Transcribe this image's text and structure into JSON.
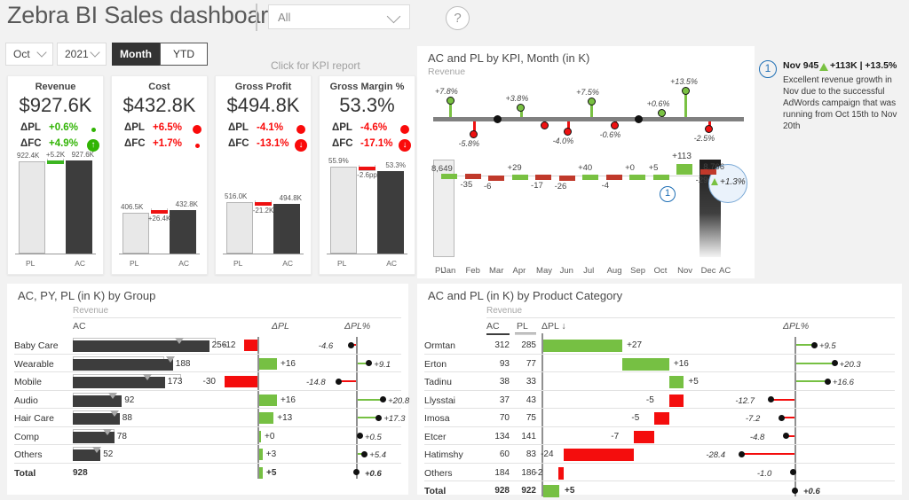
{
  "header": {
    "title": "Zebra BI Sales dashboard",
    "filter_value": "All",
    "filter_icon": "chevron-down-icon",
    "help_icon": "question-mark-icon"
  },
  "slicers": {
    "month": "Oct",
    "year": "2021",
    "toggle_month": "Month",
    "toggle_ytd": "YTD",
    "kpi_hint": "Click for KPI report"
  },
  "kpi_cards": [
    {
      "title": "Revenue",
      "value": "$927.6K",
      "d1_label": "ΔPL",
      "d1_value": "+0.6%",
      "d1_sign": "pos",
      "d1_dot": "small",
      "d2_label": "ΔFC",
      "d2_value": "+4.9%",
      "d2_sign": "pos",
      "d2_dot": "large",
      "d2_glyph": "↑",
      "pl_label": "922.4K",
      "var_label": "+5.2K",
      "ac_label": "927.6K",
      "axis_left": "PL",
      "axis_right": "AC",
      "pl_pct": 99.4,
      "ac_pct": 100,
      "var_dir": "pos",
      "var_top_pct": 0.6
    },
    {
      "title": "Cost",
      "value": "$432.8K",
      "d1_label": "ΔPL",
      "d1_value": "+6.5%",
      "d1_sign": "neg",
      "d1_dot": "medium",
      "d2_label": "ΔFC",
      "d2_value": "+1.7%",
      "d2_sign": "neg",
      "d2_dot": "small",
      "pl_label": "406.5K",
      "var_label": "+26.4K",
      "ac_label": "432.8K",
      "axis_left": "PL",
      "axis_right": "AC",
      "pl_pct": 43.8,
      "ac_pct": 46.7,
      "var_dir": "neg",
      "var_top_pct": 6.1
    },
    {
      "title": "Gross Profit",
      "value": "$494.8K",
      "d1_label": "ΔPL",
      "d1_value": "-4.1%",
      "d1_sign": "neg",
      "d1_dot": "medium",
      "d2_label": "ΔFC",
      "d2_value": "-13.1%",
      "d2_sign": "neg",
      "d2_dot": "large",
      "d2_glyph": "↓",
      "pl_label": "516.0K",
      "var_label": "-21.2K",
      "ac_label": "494.8K",
      "axis_left": "PL",
      "axis_right": "AC",
      "pl_pct": 55.6,
      "ac_pct": 53.3,
      "var_dir": "neg",
      "var_top_pct": 2.3
    },
    {
      "title": "Gross Margin %",
      "value": "53.3%",
      "d1_label": "ΔPL",
      "d1_value": "-4.6%",
      "d1_sign": "neg",
      "d1_dot": "medium",
      "d2_label": "ΔFC",
      "d2_value": "-17.1%",
      "d2_sign": "neg",
      "d2_dot": "large",
      "d2_glyph": "↓",
      "pl_label": "55.9%",
      "var_label": "-2.6pp",
      "ac_label": "53.3%",
      "axis_left": "PL",
      "axis_right": "AC",
      "pl_pct": 93.0,
      "ac_pct": 88.7,
      "var_dir": "neg",
      "var_top_pct": 4.3
    }
  ],
  "chart_top": {
    "title": "AC and PL by KPI, Month (in K)",
    "subtitle": "Revenue"
  },
  "annotation": {
    "number": "1",
    "head": "Nov 945",
    "triangle_icon": "up-triangle-icon",
    "head2": "+113K | +13.5%",
    "body": "Excellent revenue growth in Nov due to the successful AdWords campaign that was running from Oct 15th to Nov 20th"
  },
  "chart_bl": {
    "title": "AC, PY, PL (in K) by Group",
    "sub": "Revenue",
    "col_ac": "AC",
    "col_dpl": "ΔPL",
    "col_dplpct": "ΔPL%"
  },
  "chart_br": {
    "title": "AC and PL (in K) by Product Category",
    "sub": "Revenue",
    "col_ac": "AC",
    "col_pl": "PL",
    "col_dpl": "ΔPL ↓",
    "col_dplpct": "ΔPL%"
  },
  "chart_data": [
    {
      "type": "bar",
      "name": "monthly-variance-pins",
      "title": "AC and PL by KPI, Month (in K)",
      "subtitle": "Revenue",
      "categories": [
        "Jan",
        "Feb",
        "Mar",
        "Apr",
        "May",
        "Jun",
        "Jul",
        "Aug",
        "Sep",
        "Oct",
        "Nov",
        "Dec"
      ],
      "series": [
        {
          "name": "ΔPL%",
          "values": [
            7.8,
            -5.8,
            0.0,
            3.8,
            -0.5,
            -4.0,
            7.5,
            -0.6,
            0.0,
            0.6,
            13.5,
            -2.5
          ],
          "labels": [
            "+7.8%",
            "-5.8%",
            "",
            "+3.8%",
            "",
            "-4.0%",
            "+7.5%",
            "-0.6%",
            "",
            "+0.6%",
            "+13.5%",
            "-2.5%"
          ]
        },
        {
          "name": "ΔPL abs (K)",
          "values": [
            29,
            -35,
            -6,
            29,
            -17,
            -26,
            40,
            -4,
            0,
            5,
            113,
            -29
          ],
          "labels": [
            "",
            "-35",
            "-6",
            "+29",
            "-17",
            "-26",
            "+40",
            "-4",
            "+0",
            "+5",
            "+113",
            "-29"
          ]
        }
      ],
      "pl_total": "8,649",
      "ac_total": "8,766",
      "total_variance_pct": "+1.3%",
      "axis_start_label": "PL",
      "axis_end_label": "AC",
      "marker": "1"
    },
    {
      "type": "bar",
      "name": "by-group",
      "title": "AC, PY, PL (in K) by Group",
      "subtitle": "Revenue",
      "columns": [
        "Group",
        "AC",
        "ΔPL",
        "ΔPL%"
      ],
      "categories": [
        "Baby Care",
        "Wearable",
        "Mobile",
        "Audio",
        "Hair Care",
        "Comp",
        "Others"
      ],
      "ac": [
        256,
        188,
        173,
        92,
        88,
        78,
        52
      ],
      "py_marker": [
        200,
        183,
        140,
        75,
        78,
        65,
        45
      ],
      "pl_ref": [
        268,
        172,
        203,
        76,
        75,
        78,
        49
      ],
      "dpl": [
        -12,
        16,
        -30,
        16,
        13,
        0,
        3
      ],
      "dpl_labels": [
        "-12",
        "+16",
        "-30",
        "+16",
        "+13",
        "+0",
        "+3"
      ],
      "dplpct": [
        -4.6,
        9.1,
        -14.8,
        20.8,
        17.3,
        0.5,
        5.4
      ],
      "dplpct_labels": [
        "-4.6",
        "+9.1",
        "-14.8",
        "+20.8",
        "+17.3",
        "+0.5",
        "+5.4"
      ],
      "total_label": "Total",
      "total_ac": "928",
      "total_dpl": "+5",
      "total_dplpct": "+0.6"
    },
    {
      "type": "bar",
      "name": "by-product-category",
      "title": "AC and PL (in K) by Product Category",
      "subtitle": "Revenue",
      "columns": [
        "Product Category",
        "AC",
        "PL",
        "ΔPL ↓",
        "ΔPL%"
      ],
      "categories": [
        "Ormtan",
        "Erton",
        "Tadinu",
        "Llysstai",
        "Imosa",
        "Etcer",
        "Hatimshy",
        "Others"
      ],
      "ac": [
        312,
        93,
        38,
        37,
        70,
        134,
        60,
        184
      ],
      "pl": [
        285,
        77,
        33,
        43,
        75,
        141,
        83,
        186
      ],
      "dpl": [
        27,
        16,
        5,
        -5,
        -5,
        -7,
        -24,
        -2
      ],
      "dpl_labels": [
        "+27",
        "+16",
        "+5",
        "-5",
        "-5",
        "-7",
        "-24",
        "-2"
      ],
      "dplpct": [
        9.5,
        20.3,
        16.6,
        -12.7,
        -7.2,
        -4.8,
        -28.4,
        -1.0
      ],
      "dplpct_labels": [
        "+9.5",
        "+20.3",
        "+16.6",
        "-12.7",
        "-7.2",
        "-4.8",
        "-28.4",
        "-1.0"
      ],
      "total_label": "Total",
      "total_ac": "928",
      "total_pl": "922",
      "total_dpl": "+5",
      "total_dplpct": "+0.6"
    }
  ]
}
